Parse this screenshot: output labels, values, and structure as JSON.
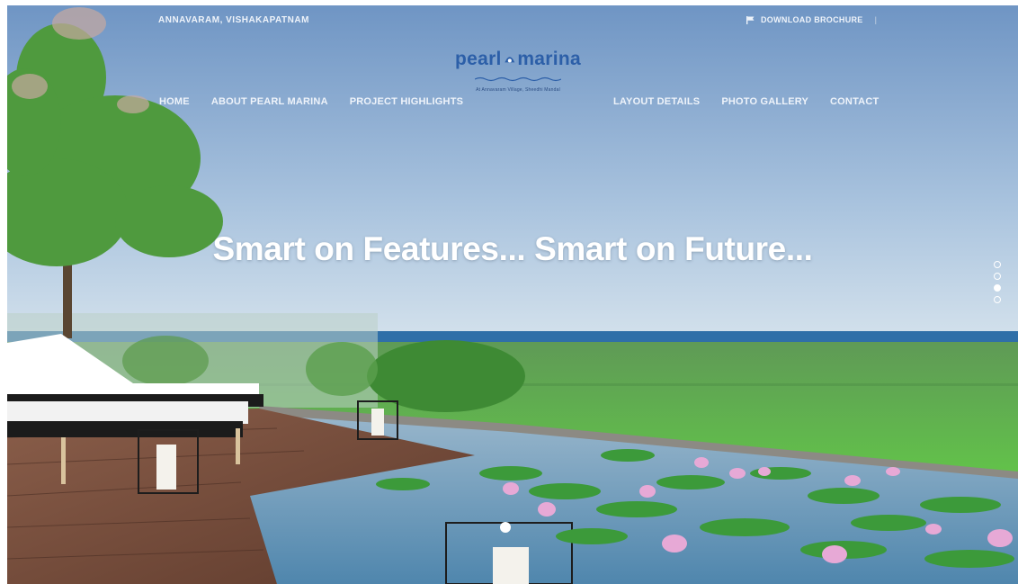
{
  "header": {
    "location": "ANNAVARAM, VISHAKAPATNAM",
    "brochure_label": "DOWNLOAD BROCHURE",
    "brochure_separator": "|"
  },
  "logo": {
    "word_left": "pearl",
    "word_right": "marina",
    "tagline": "At Annavaram Village, Sheedhi Mandal"
  },
  "nav": {
    "left": [
      "HOME",
      "ABOUT PEARL MARINA",
      "PROJECT HIGHLIGHTS"
    ],
    "right": [
      "LAYOUT DETAILS",
      "PHOTO GALLERY",
      "CONTACT"
    ]
  },
  "hero": {
    "headline": "Smart on Features... Smart on Future...",
    "slide_count": 4,
    "active_slide": 3
  },
  "colors": {
    "sky_top": "#6f95c4",
    "sky_bottom": "#c9dbea",
    "sea": "#2f6fa8",
    "grass": "#5fbf4a",
    "pool": "#5f93b8",
    "deck": "#7a4f3c",
    "logo_blue": "#2c5fa8"
  },
  "icons": {
    "brochure": "flag-icon",
    "slide_indicator": "circle-dot-icon",
    "logo_mark": "pearl-shell-icon"
  }
}
